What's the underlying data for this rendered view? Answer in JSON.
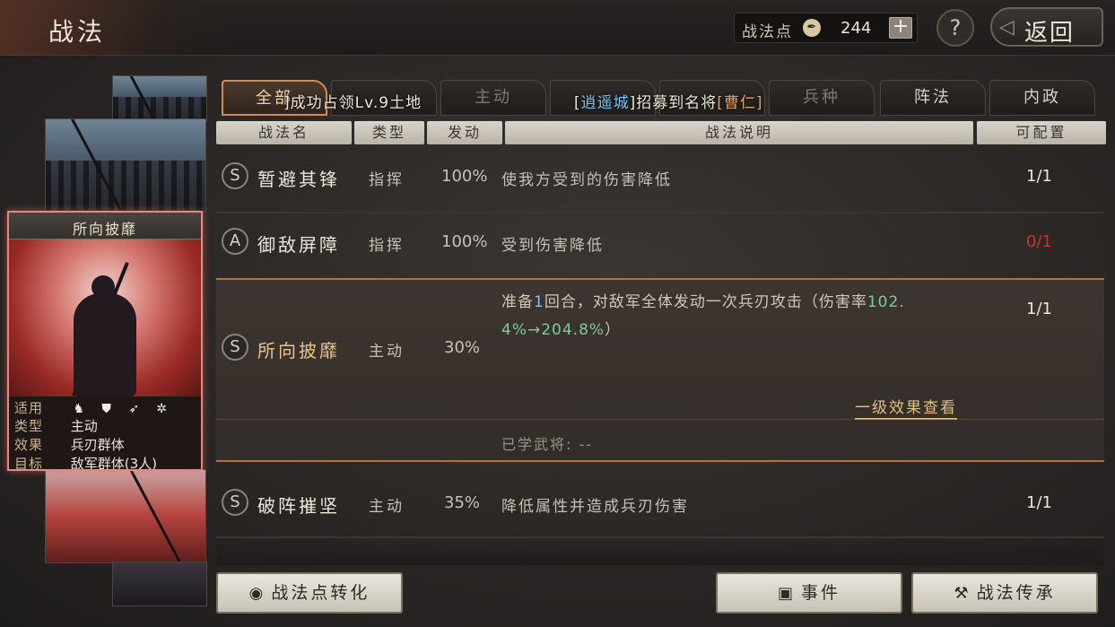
{
  "header": {
    "title": "战法",
    "points_label": "战法点",
    "points_icon": "feather-coin-icon",
    "points_value": "244",
    "plus_label": "+",
    "help_label": "?",
    "back_label": "返回"
  },
  "tabs": [
    {
      "label": "全部",
      "active": true
    },
    {
      "label": "",
      "active": false
    },
    {
      "label": "主动",
      "active": false
    },
    {
      "label": "",
      "active": false
    },
    {
      "label": "",
      "active": false
    },
    {
      "label": "兵种",
      "active": false
    },
    {
      "label": "阵法",
      "active": false
    },
    {
      "label": "内政",
      "active": false
    }
  ],
  "notifications": {
    "n1_prefix": "]成功占领Lv.9土地",
    "n2_open": "[",
    "n2_city": "逍遥城",
    "n2_mid": "]招募到名将",
    "n2_general": "[曹仁]"
  },
  "columns": {
    "name": "战法名",
    "type": "类型",
    "trigger": "发动",
    "desc": "战法说明",
    "config": "可配置"
  },
  "skills": [
    {
      "grade": "S",
      "name": "暂避其锋",
      "type": "指挥",
      "rate": "100%",
      "desc": "使我方受到的伤害降低",
      "config": "1/1"
    },
    {
      "grade": "A",
      "name": "御敌屏障",
      "type": "指挥",
      "rate": "100%",
      "desc": "受到伤害降低",
      "config": "0/1"
    },
    {
      "grade": "S",
      "name": "所向披靡",
      "type": "主动",
      "rate": "30%",
      "desc_a": "准备",
      "desc_n1": "1",
      "desc_b": "回合，对敌军全体发动一次兵刃攻击（伤害率",
      "desc_n2": "102.",
      "desc_c": "4%→204.8%",
      "desc_d": "）",
      "config": "1/1",
      "level_link": "一级效果查看",
      "learned_label": "已学武将:",
      "learned_value": "--"
    },
    {
      "grade": "S",
      "name": "破阵摧坚",
      "type": "主动",
      "rate": "35%",
      "desc": "降低属性并造成兵刃伤害",
      "config": "1/1"
    }
  ],
  "selected_card": {
    "title": "所向披靡",
    "applies_label": "适用",
    "troop_icons": [
      "cavalry-icon",
      "shield-icon",
      "bow-icon",
      "wheel-icon"
    ],
    "type_label": "类型",
    "type_value": "主动",
    "effect_label": "效果",
    "effect_value": "兵刃群体",
    "target_label": "目标",
    "target_value": "敌军群体(3人)"
  },
  "buttons": {
    "convert": "战法点转化",
    "event": "事件",
    "inherit": "战法传承"
  },
  "colors": {
    "accent_gold": "#e6c48a",
    "tab_active_border": "#d48c4e",
    "config_red": "#d2302a",
    "card_border": "#e18a83"
  }
}
